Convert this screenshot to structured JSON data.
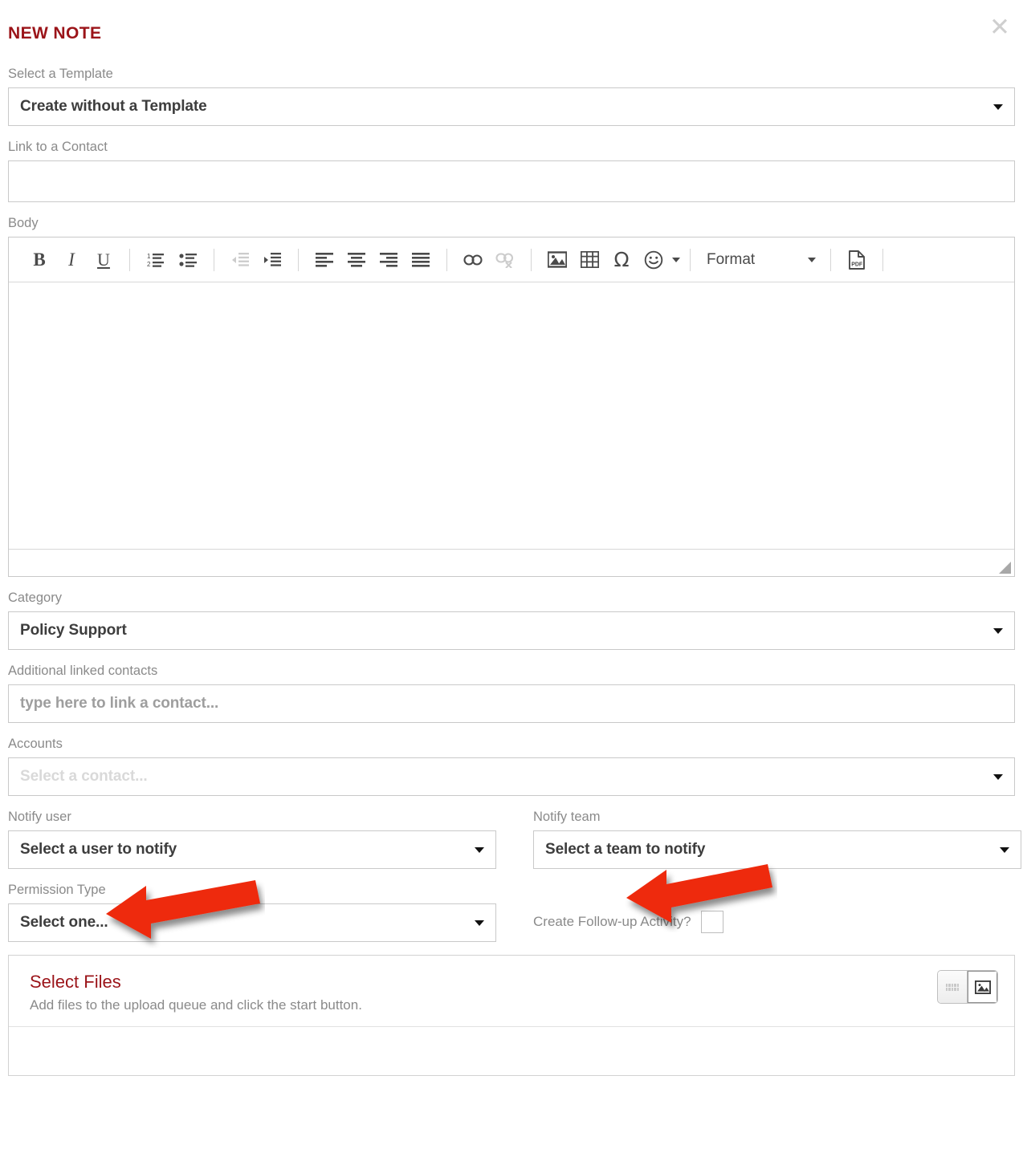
{
  "modal": {
    "title": "NEW NOTE",
    "close_icon": "close-icon"
  },
  "fields": {
    "template": {
      "label": "Select a Template",
      "value": "Create without a Template"
    },
    "link_contact": {
      "label": "Link to a Contact",
      "value": ""
    },
    "body": {
      "label": "Body",
      "value": ""
    },
    "category": {
      "label": "Category",
      "value": "Policy Support"
    },
    "additional_contacts": {
      "label": "Additional linked contacts",
      "placeholder": "type here to link a contact..."
    },
    "accounts": {
      "label": "Accounts",
      "placeholder": "Select a contact..."
    },
    "notify_user": {
      "label": "Notify user",
      "value": "Select a user to notify"
    },
    "notify_team": {
      "label": "Notify team",
      "value": "Select a team to notify"
    },
    "permission_type": {
      "label": "Permission Type",
      "value": "Select one..."
    },
    "follow_up": {
      "label": "Create Follow-up Activity?",
      "checked": false
    }
  },
  "editor": {
    "toolbar": {
      "bold": "B",
      "italic": "I",
      "underline": "U",
      "omega": "Ω",
      "format_label": "Format",
      "buttons": [
        "bold",
        "italic",
        "underline",
        "numbered-list",
        "bulleted-list",
        "outdent",
        "indent",
        "align-left",
        "align-center",
        "align-right",
        "align-justify",
        "link",
        "unlink",
        "image",
        "table",
        "special-character",
        "emoji",
        "format",
        "export-pdf"
      ]
    }
  },
  "upload": {
    "title": "Select Files",
    "subtitle": "Add files to the upload queue and click the start button.",
    "view_toggle": {
      "list_icon": "dots-grid-icon",
      "thumbnail_icon": "image-thumbnail-icon",
      "active": "thumbnail"
    }
  },
  "annotations": {
    "arrow_color": "#EE2B10",
    "arrows": [
      {
        "name": "arrow-notify-user",
        "points_to": "Notify user"
      },
      {
        "name": "arrow-notify-team",
        "points_to": "Notify team"
      }
    ]
  }
}
